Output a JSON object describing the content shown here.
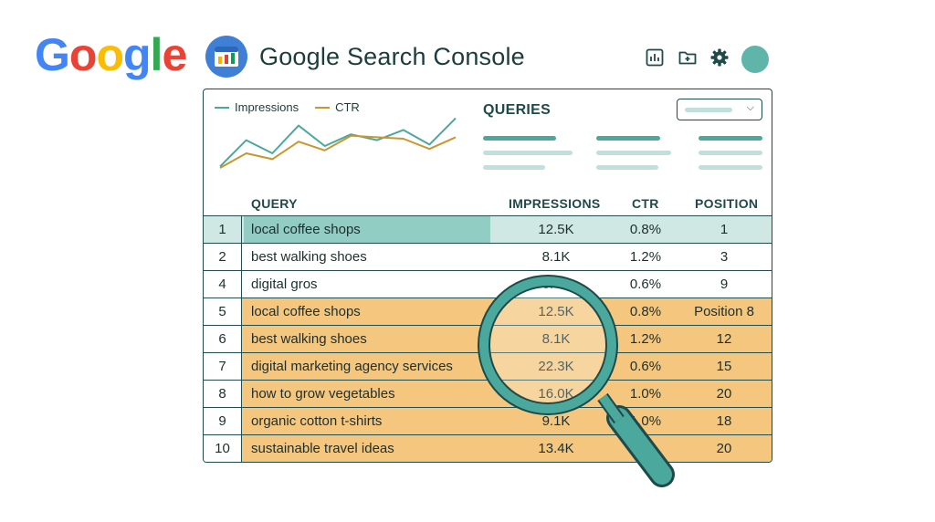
{
  "logo": {
    "letters": [
      "G",
      "o",
      "o",
      "g",
      "l",
      "e"
    ],
    "colors": [
      "#4285F4",
      "#EA4335",
      "#FBBC05",
      "#4285F4",
      "#34A853",
      "#EA4335"
    ]
  },
  "app_title": "Google Search Console",
  "toolbar": {
    "icons": [
      "bar-chart-icon",
      "new-folder-icon",
      "gear-icon",
      "avatar"
    ]
  },
  "chart": {
    "legend": [
      {
        "name": "Impressions",
        "color": "#4aa89d"
      },
      {
        "name": "CTR",
        "color": "#c9962f"
      }
    ]
  },
  "chart_data": {
    "type": "line",
    "x": [
      1,
      2,
      3,
      4,
      5,
      6,
      7,
      8,
      9
    ],
    "series": [
      {
        "name": "Impressions",
        "values": [
          12,
          48,
          30,
          68,
          40,
          56,
          48,
          62,
          42,
          78
        ]
      },
      {
        "name": "CTR",
        "values": [
          10,
          30,
          22,
          46,
          34,
          54,
          52,
          50,
          36,
          52
        ]
      }
    ],
    "grid": false,
    "legend_position": "top-left"
  },
  "queries": {
    "title": "QUERIES"
  },
  "table": {
    "headers": {
      "query": "QUERY",
      "impressions": "IMPRESSIONS",
      "ctr": "CTR",
      "position": "POSITION"
    },
    "rows": [
      {
        "num": "1",
        "query": "local coffee shops",
        "impressions": "12.5K",
        "ctr": "0.8%",
        "position": "1",
        "style": "sel"
      },
      {
        "num": "2",
        "query": "best walking shoes",
        "impressions": "8.1K",
        "ctr": "1.2%",
        "position": "3",
        "style": ""
      },
      {
        "num": "4",
        "query": "digital gros",
        "impressions": "6.4K",
        "ctr": "0.6%",
        "position": "9",
        "style": ""
      },
      {
        "num": "5",
        "query": "local coffee shops",
        "impressions": "12.5K",
        "ctr": "0.8%",
        "position": "Position 8",
        "style": "hl"
      },
      {
        "num": "6",
        "query": "best walking shoes",
        "impressions": "8.1K",
        "ctr": "1.2%",
        "position": "12",
        "style": "hl"
      },
      {
        "num": "7",
        "query": "digital marketing agency services",
        "impressions": "22.3K",
        "ctr": "0.6%",
        "position": "15",
        "style": "hl"
      },
      {
        "num": "8",
        "query": "how to grow vegetables",
        "impressions": "16.0K",
        "ctr": "1.0%",
        "position": "20",
        "style": "hl"
      },
      {
        "num": "9",
        "query": "organic cotton t-shirts",
        "impressions": "9.1K",
        "ctr": "1.0%",
        "position": "18",
        "style": "hl"
      },
      {
        "num": "10",
        "query": "sustainable travel ideas",
        "impressions": "13.4K",
        "ctr": "",
        "position": "20",
        "style": "hl"
      }
    ]
  },
  "colors": {
    "accent": "#4aa89d",
    "highlight": "#f5c77e",
    "selected": "#cfe8e4",
    "border": "#1f4a4a"
  }
}
